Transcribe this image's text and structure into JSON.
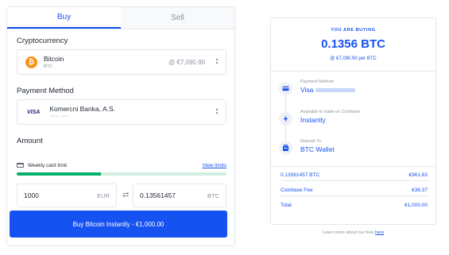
{
  "tabs": [
    {
      "label": "Buy",
      "active": true
    },
    {
      "label": "Sell",
      "active": false
    }
  ],
  "crypto": {
    "section_label": "Cryptocurrency",
    "icon_glyph": "₿",
    "name": "Bitcoin",
    "symbol": "BTC",
    "price": "@ €7,090.90"
  },
  "payment": {
    "section_label": "Payment Method",
    "card_brand": "VISA",
    "bank_name": "Komercni Banka, A.S.",
    "bank_sub": "••••• ••••"
  },
  "amount": {
    "section_label": "Amount",
    "limit_label": "Weekly card limit",
    "limit_link": "View limits",
    "limit_progress": 0.4,
    "fiat_value": "1000",
    "fiat_currency": "EUR",
    "crypto_value": "0.13561457",
    "crypto_currency": "BTC",
    "swap_glyph": "⇄"
  },
  "buy_button": "Buy Bitcoin Instantly - €1,000.00",
  "summary": {
    "heading": "YOU ARE BUYING",
    "amount": "0.1356 BTC",
    "per_price": "@ €7,090.90 per BTC",
    "steps": [
      {
        "label": "Payment Method",
        "value": "Visa",
        "icon": "card-icon"
      },
      {
        "label": "Available to trade on Coinbase",
        "value": "Instantly",
        "icon": "lightning-icon"
      },
      {
        "label": "Deposit To",
        "value": "BTC Wallet",
        "icon": "wallet-icon"
      }
    ],
    "rows": [
      {
        "label": "0.13561457 BTC",
        "value": "€961.63"
      },
      {
        "label": "Coinbase Fee",
        "value": "€38.37"
      },
      {
        "label": "Total",
        "value": "€1,000.00"
      }
    ],
    "fees_text": "Learn more about our fees",
    "fees_link": "here"
  },
  "colors": {
    "accent": "#1652f0",
    "bitcoin": "#f7931a",
    "progress": "#05b169"
  }
}
